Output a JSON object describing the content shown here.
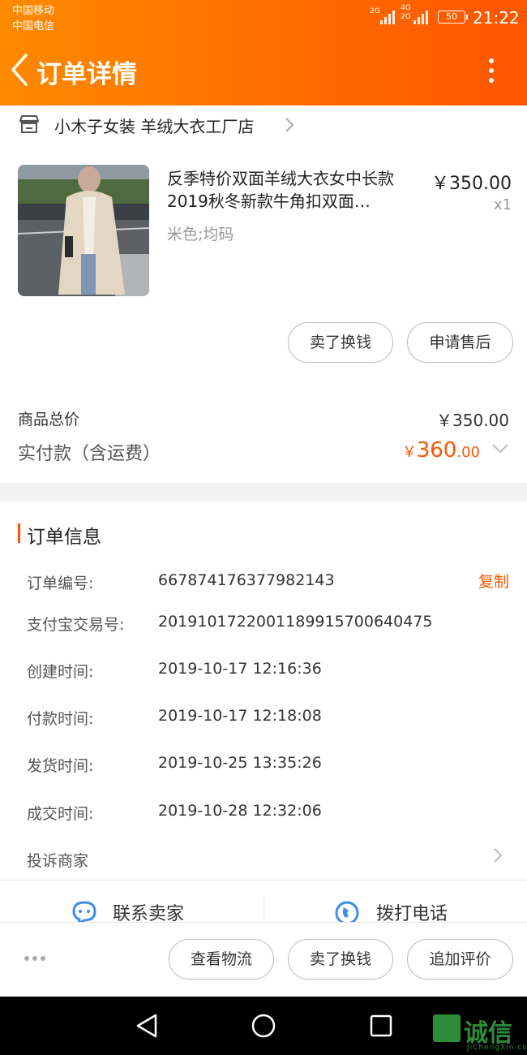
{
  "status_bar": {
    "carrier1": "中国移动",
    "carrier2": "中国电信",
    "net1": "2G",
    "net2": "4G",
    "net3": "2G",
    "battery": "50",
    "time": "21:22"
  },
  "header": {
    "title": "订单详情",
    "back_icon": "chevron-left-icon",
    "more_icon": "more-vertical-icon"
  },
  "shop": {
    "name": "小木子女装 羊绒大衣工厂店",
    "icon": "store-icon"
  },
  "product": {
    "title": "反季特价双面羊绒大衣女中长款2019秋冬新款牛角扣双面…",
    "sku": "米色;均码",
    "price": "￥350.00",
    "qty": "x1"
  },
  "card_actions": {
    "sell_label": "卖了换钱",
    "after_sale_label": "申请售后"
  },
  "summary": {
    "subtotal_label": "商品总价",
    "subtotal_value": "￥350.00",
    "paid_label": "实付款（含运费）",
    "paid_currency": "￥",
    "paid_int": "360",
    "paid_dec": ".00"
  },
  "order_info": {
    "title": "订单信息",
    "copy_label": "复制",
    "rows": [
      {
        "label": "订单编号:",
        "value": "667874176377982143"
      },
      {
        "label": "支付宝交易号:",
        "value": "2019101722001189915700640475"
      },
      {
        "label": "创建时间:",
        "value": "2019-10-17 12:16:36"
      },
      {
        "label": "付款时间:",
        "value": "2019-10-17 12:18:08"
      },
      {
        "label": "发货时间:",
        "value": "2019-10-25 13:35:26"
      },
      {
        "label": "成交时间:",
        "value": "2019-10-28 12:32:06"
      }
    ],
    "complain_label": "投诉商家",
    "contact_seller": "联系卖家",
    "call_phone": "拨打电话"
  },
  "bottom_bar": {
    "logistics_label": "查看物流",
    "sell_label": "卖了换钱",
    "review_label": "追加评价"
  },
  "watermark": {
    "text": "诚信",
    "sub": "JiChengXin.com"
  },
  "colors": {
    "accent": "#ff5500",
    "header_start": "#ff8a00",
    "header_end": "#ff5500"
  }
}
